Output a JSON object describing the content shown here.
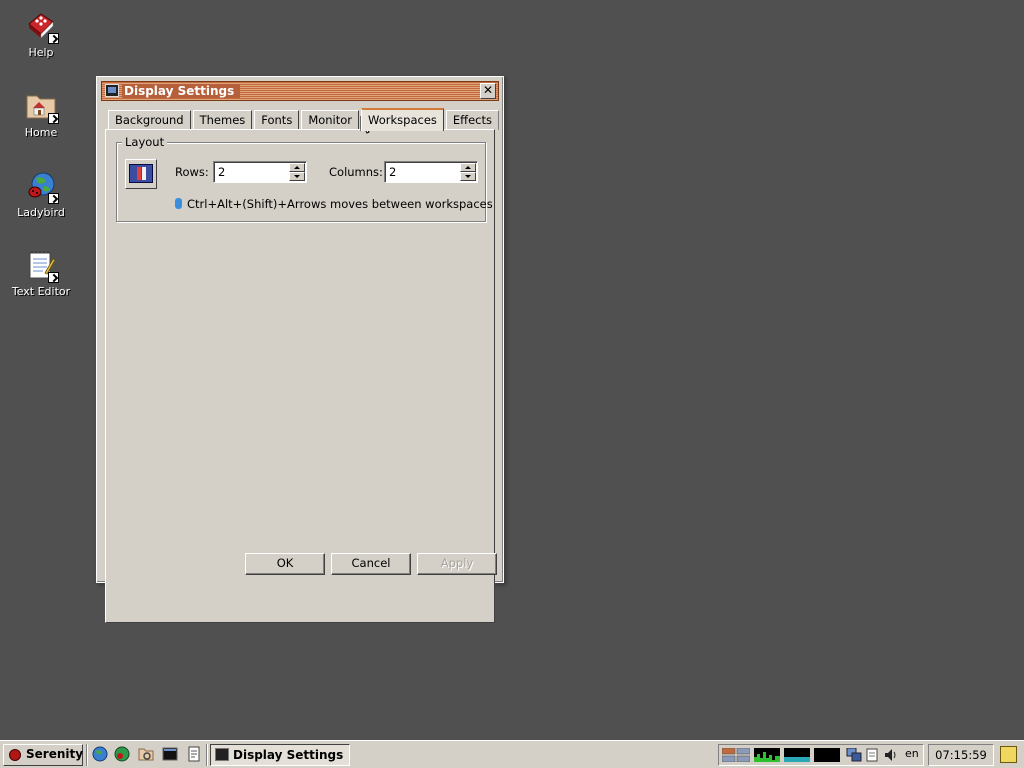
{
  "desktop": {
    "icons": [
      {
        "label": "Help"
      },
      {
        "label": "Home"
      },
      {
        "label": "Ladybird"
      },
      {
        "label": "Text Editor"
      }
    ]
  },
  "window": {
    "title": "Display Settings",
    "close_glyph": "✕",
    "tabs": [
      {
        "label": "Background"
      },
      {
        "label": "Themes"
      },
      {
        "label": "Fonts"
      },
      {
        "label": "Monitor"
      },
      {
        "label": "Workspaces"
      },
      {
        "label": "Effects"
      }
    ],
    "active_tab": "Workspaces",
    "layout": {
      "legend": "Layout",
      "rows_label": "Rows:",
      "rows_value": "2",
      "columns_label": "Columns:",
      "columns_value": "2",
      "hint": "Ctrl+Alt+(Shift)+Arrows moves between workspaces"
    },
    "buttons": {
      "ok": "OK",
      "cancel": "Cancel",
      "apply": "Apply"
    }
  },
  "taskbar": {
    "start_label": "Serenity",
    "task_label": "Display Settings",
    "keyboard_layout": "en",
    "clock": "07:15:59"
  },
  "colors": {
    "desktop": "#505050",
    "titlebar_accent": "#c06a3e",
    "active_tab_accent": "#d17a3a",
    "chrome": "#d4d0c8"
  }
}
